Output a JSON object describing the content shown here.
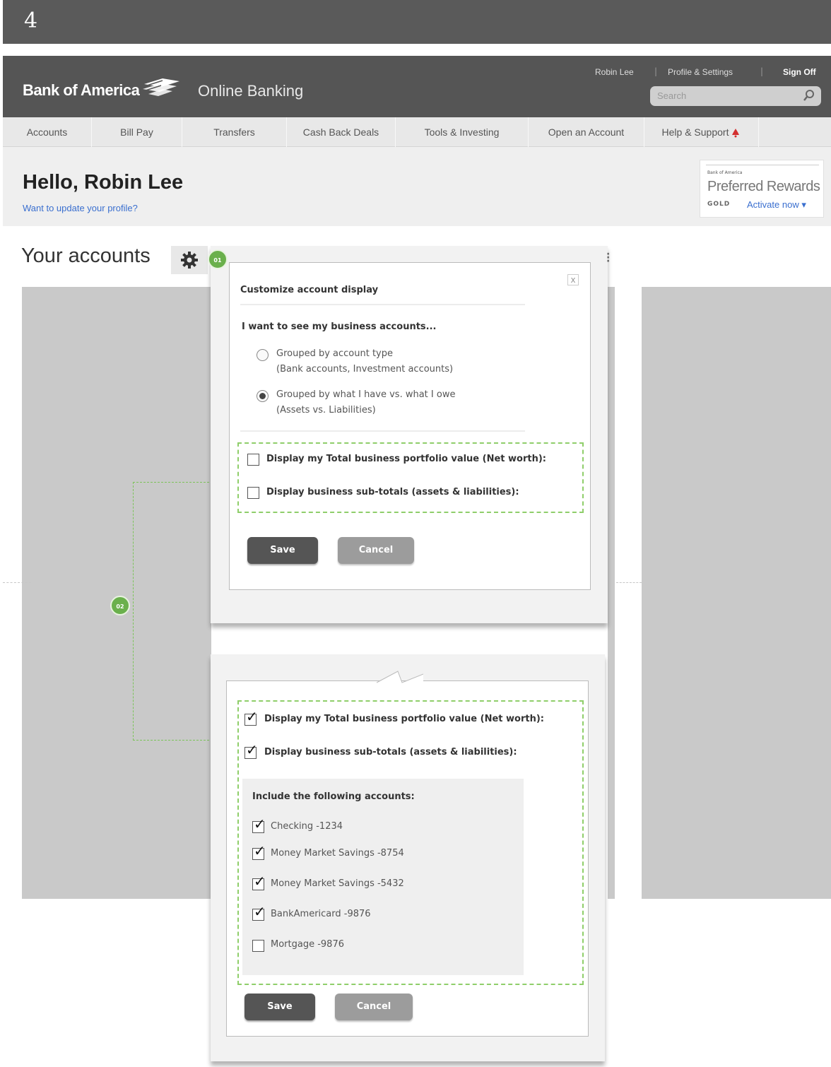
{
  "step": {
    "number": "4"
  },
  "header": {
    "logo_text": "Bank of America",
    "product_name": "Online Banking",
    "user_name": "Robin Lee",
    "profile_settings": "Profile & Settings",
    "sign_off": "Sign Off",
    "search_placeholder": "Search"
  },
  "nav": {
    "items": [
      "Accounts",
      "Bill Pay",
      "Transfers",
      "Cash Back Deals",
      "Tools & Investing",
      "Open an Account",
      "Help & Support"
    ]
  },
  "greeting": {
    "title": "Hello, Robin Lee",
    "profile_link": "Want to update your profile?"
  },
  "rewards": {
    "brand_small": "Bank of America",
    "title": "Preferred Rewards",
    "tier": "GOLD",
    "activate": "Activate now ▾"
  },
  "accounts": {
    "title": "Your accounts"
  },
  "markers": {
    "m1": "01",
    "m2": "02"
  },
  "dialog1": {
    "title": "Customize account display",
    "close": "x",
    "question": "I want to see my business accounts...",
    "options": [
      {
        "label": "Grouped by account type",
        "sub": "(Bank accounts, Investment accounts)",
        "selected": false
      },
      {
        "label": "Grouped by what I have vs. what I owe",
        "sub": "(Assets vs. Liabilities)",
        "selected": true
      }
    ],
    "checkboxes": [
      {
        "label": "Display my Total business portfolio value (Net worth):",
        "checked": false
      },
      {
        "label": "Display business sub-totals (assets & liabilities):",
        "checked": false
      }
    ],
    "save": "Save",
    "cancel": "Cancel"
  },
  "dialog2": {
    "checkboxes": [
      {
        "label": "Display my Total business portfolio value (Net worth):",
        "checked": true
      },
      {
        "label": "Display business sub-totals (assets & liabilities):",
        "checked": true
      }
    ],
    "include_title": "Include the following accounts:",
    "accounts": [
      {
        "label": "Checking -1234",
        "checked": true
      },
      {
        "label": "Money Market Savings -8754",
        "checked": true
      },
      {
        "label": "Money Market Savings -5432",
        "checked": true
      },
      {
        "label": "BankAmericard -9876",
        "checked": true
      },
      {
        "label": "Mortgage -9876",
        "checked": false
      }
    ],
    "save": "Save",
    "cancel": "Cancel"
  },
  "colors": {
    "header": "#555555",
    "annotation_green": "#6ab04c",
    "link": "#3a6fcf"
  }
}
